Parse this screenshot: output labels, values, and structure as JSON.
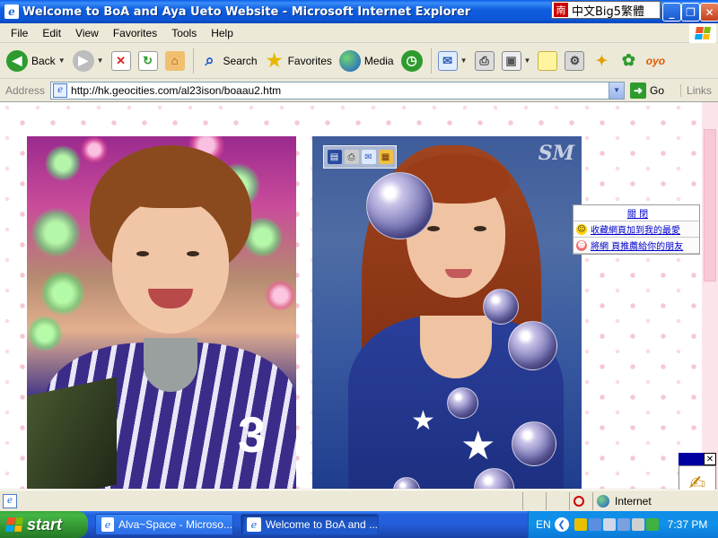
{
  "window": {
    "title": "Welcome to BoA and Aya Ueto Website - Microsoft Internet Explorer",
    "ime_label": "中文Big5繁體",
    "ime_icon": "南"
  },
  "menu": [
    "File",
    "Edit",
    "View",
    "Favorites",
    "Tools",
    "Help"
  ],
  "toolbar": {
    "back_label": "Back",
    "search_label": "Search",
    "favorites_label": "Favorites",
    "media_label": "Media"
  },
  "address": {
    "label": "Address",
    "url": "http://hk.geocities.com/al23ison/boaau2.htm",
    "go_label": "Go",
    "links_label": "Links"
  },
  "content": {
    "watermark": "SM",
    "popup": {
      "header": "關 閉",
      "row1": "收藏網頁加到我的最愛",
      "row2": "將網 頁推薦給你的朋友"
    },
    "widget_close": "✕"
  },
  "status": {
    "zone_label": "Internet"
  },
  "taskbar": {
    "start_label": "start",
    "tasks": [
      {
        "label": "Alva~Space - Microso..."
      },
      {
        "label": "Welcome to BoA and ..."
      }
    ],
    "language": "EN",
    "time": "7:37 PM"
  },
  "colors": {
    "titlebar": "#0f5fe0",
    "taskbar": "#245edb",
    "start_green": "#2f8f2f",
    "page_pattern_pink": "#f6c8d4"
  }
}
